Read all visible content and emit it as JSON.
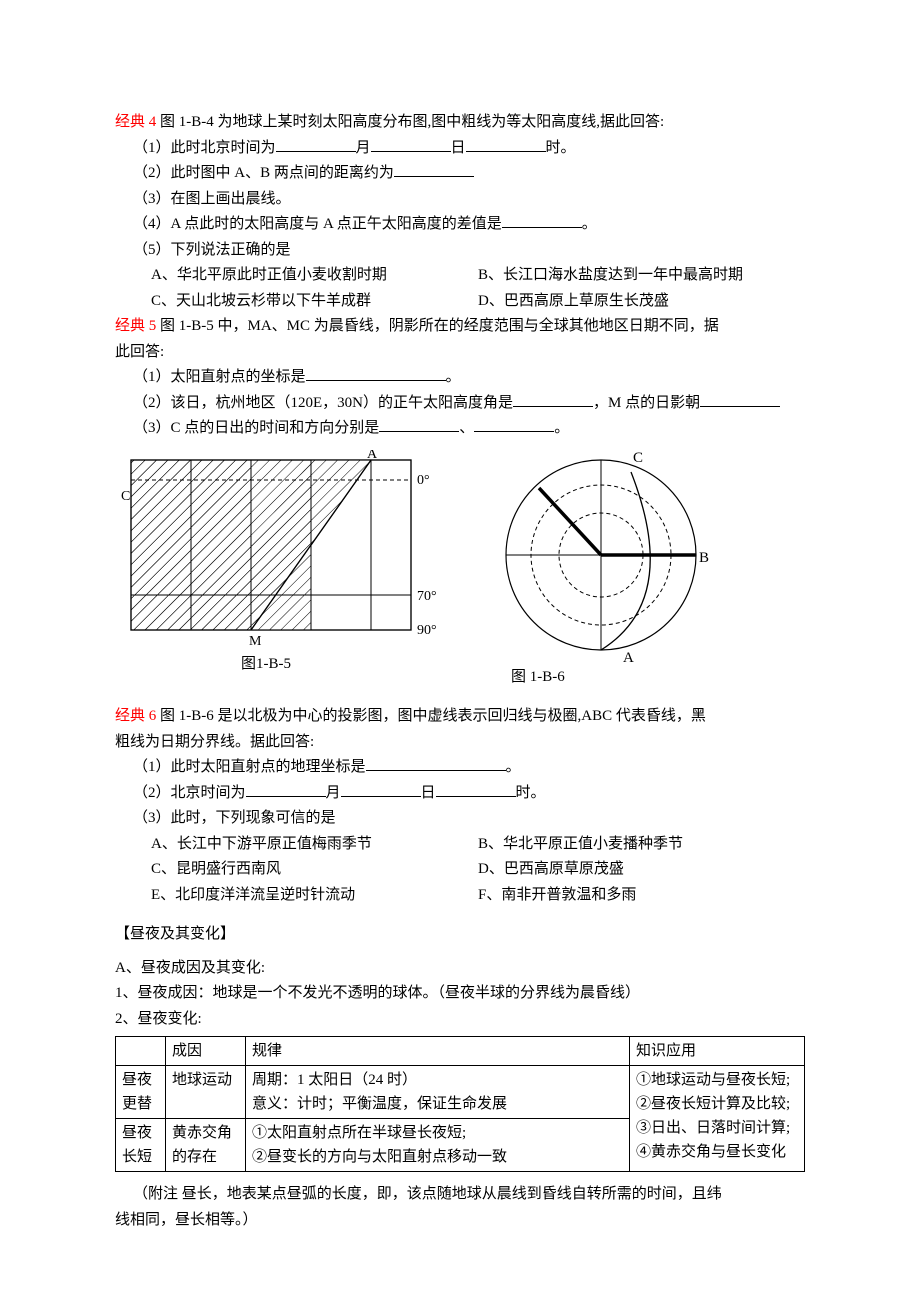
{
  "q4": {
    "label": "经典 4",
    "intro": "  图 1-B-4 为地球上某时刻太阳高度分布图,图中粗线为等太阳高度线,据此回答:",
    "p1": "（1）此时北京时间为",
    "p1_b": "月",
    "p1_c": "日",
    "p1_d": "时。",
    "p2": "（2）此时图中 A、B 两点间的距离约为",
    "p3": "（3）在图上画出晨线。",
    "p4": "（4）A 点此时的太阳高度与 A 点正午太阳高度的差值是",
    "p5": "（5）下列说法正确的是",
    "oA": "A、华北平原此时正值小麦收割时期",
    "oB": "B、长江口海水盐度达到一年中最高时期",
    "oC": "C、天山北坡云杉带以下牛羊成群",
    "oD": "D、巴西高原上草原生长茂盛"
  },
  "q5": {
    "label": "经典 5",
    "intro": "  图 1-B-5 中，MA、MC 为晨昏线，阴影所在的经度范围与全球其他地区日期不同，据",
    "intro2": "此回答:",
    "p1": "（1）太阳直射点的坐标是",
    "p1_end": "。",
    "p2": "（2）该日，杭州地区（120E，30N）的正午太阳高度角是",
    "p2_mid": "，M 点的日影朝",
    "p3": "（3）C 点的日出的时间和方向分别是",
    "p3_mid": "、",
    "p3_end": "。"
  },
  "fig5": {
    "A": "A",
    "C": "C",
    "M": "M",
    "deg0": "0°",
    "deg70": "70°",
    "deg90": "90°",
    "cap": "图1-B-5"
  },
  "fig6": {
    "A": "A",
    "B": "B",
    "C": "C",
    "cap": "图 1-B-6"
  },
  "q6": {
    "label": "经典 6",
    "intro": " 图 1-B-6 是以北极为中心的投影图，图中虚线表示回归线与极圈,ABC 代表昏线，黑",
    "intro2": "粗线为日期分界线。据此回答:",
    "p1": "（1）此时太阳直射点的地理坐标是",
    "p1_end": "。",
    "p2": "（2）北京时间为",
    "p2_b": "月",
    "p2_c": "日",
    "p2_d": "时。",
    "p3": "（3）此时，下列现象可信的是",
    "oA": "A、长江中下游平原正值梅雨季节",
    "oB": "B、华北平原正值小麦播种季节",
    "oC": "C、昆明盛行西南风",
    "oD": "D、巴西高原草原茂盛",
    "oE": "E、北印度洋洋流呈逆时针流动",
    "oF": "F、南非开普敦温和多雨"
  },
  "sec": {
    "title": "【昼夜及其变化】",
    "lA": "A、昼夜成因及其变化:",
    "l1": "1、昼夜成因：地球是一个不发光不透明的球体。（昼夜半球的分界线为晨昏线）",
    "l2": "2、昼夜变化:"
  },
  "tbl": {
    "h1": "成因",
    "h2": "规律",
    "h3": "知识应用",
    "r1c0a": "昼夜",
    "r1c0b": "更替",
    "r1c1": "地球运动",
    "r1c2a": "周期：1 太阳日（24 时）",
    "r1c2b": "意义：计时；平衡温度，保证生命发展",
    "r3a": "①地球运动与昼夜长短;",
    "r3b": "②昼夜长短计算及比较;",
    "r3c": "③日出、日落时间计算;",
    "r3d": "④黄赤交角与昼长变化",
    "r2c0a": "昼夜",
    "r2c0b": "长短",
    "r2c1a": "黄赤交角",
    "r2c1b": "的存在",
    "r2c2a": "①太阳直射点所在半球昼长夜短;",
    "r2c2b": "②昼变长的方向与太阳直射点移动一致"
  },
  "note": {
    "l1": "（附注 昼长，地表某点昼弧的长度，即，该点随地球从晨线到昏线自转所需的时间，且纬",
    "l2": "线相同，昼长相等。）"
  }
}
